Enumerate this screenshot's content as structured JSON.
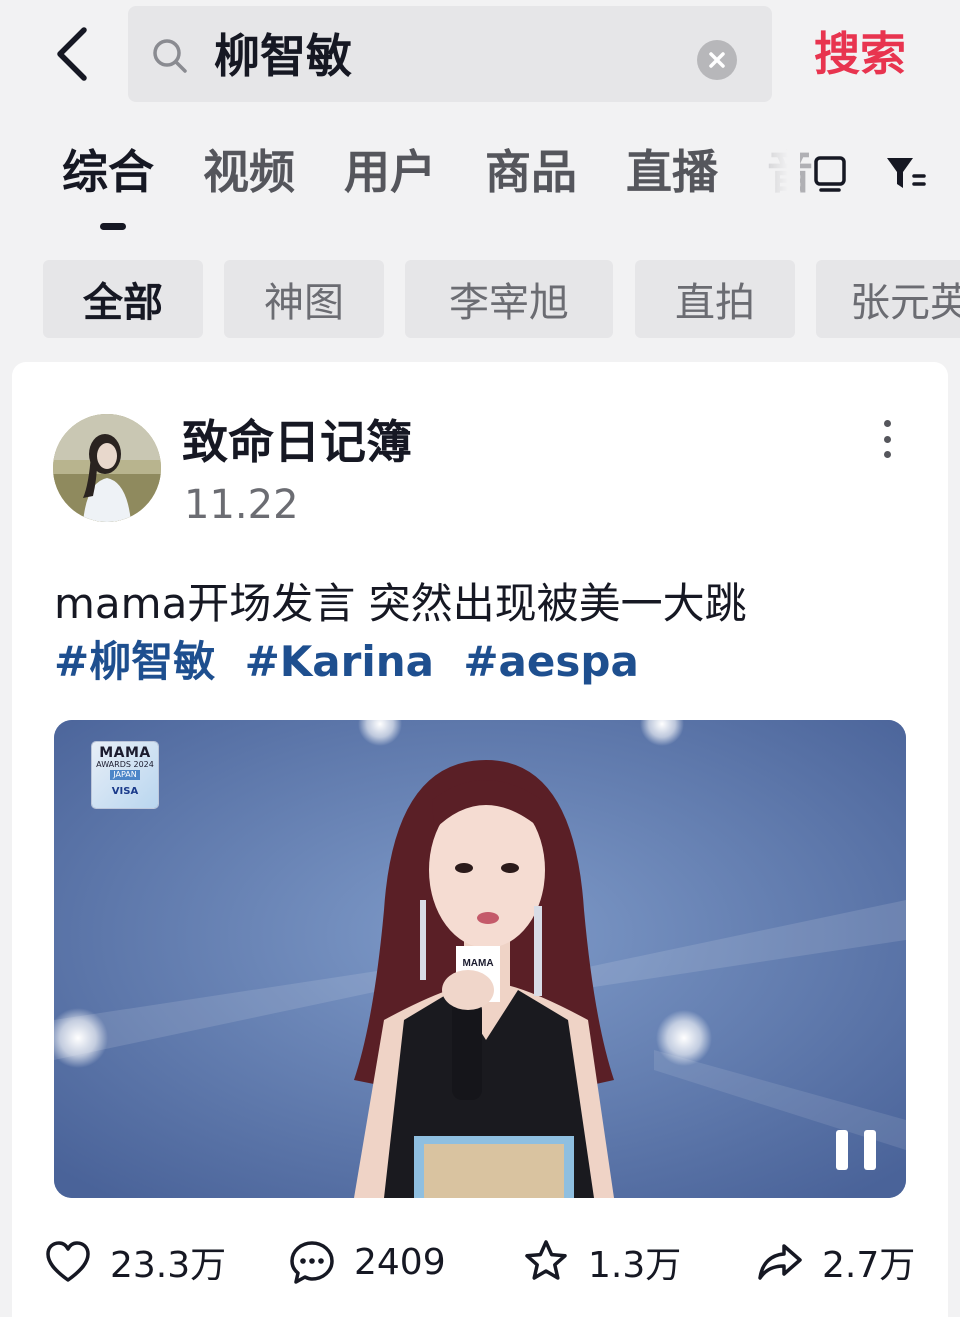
{
  "search": {
    "query": "柳智敏",
    "submit_label": "搜索"
  },
  "tabs": [
    {
      "label": "综合",
      "active": true
    },
    {
      "label": "视频"
    },
    {
      "label": "用户"
    },
    {
      "label": "商品"
    },
    {
      "label": "直播"
    },
    {
      "label": "音"
    }
  ],
  "tab_icons": [
    "screen-icon",
    "filter-icon"
  ],
  "chips": [
    {
      "label": "全部",
      "active": true
    },
    {
      "label": "神图"
    },
    {
      "label": "李宰旭"
    },
    {
      "label": "直拍"
    },
    {
      "label": "张元英"
    }
  ],
  "post": {
    "author": "致命日记簿",
    "date": "11.22",
    "caption": "mama开场发言 突然出现被美一大跳",
    "hashtags": [
      "#柳智敏",
      "#Karina",
      "#aespa"
    ],
    "video": {
      "logo_line1": "MAMA",
      "logo_line2": "AWARDS 2024",
      "logo_line3": "JAPAN",
      "logo_line4": "VISA",
      "mic_flag_text": "MAMA",
      "state": "playing"
    },
    "stats": {
      "likes": "23.3万",
      "comments": "2409",
      "favorites": "1.3万",
      "shares": "2.7万"
    }
  },
  "colors": {
    "accent": "#e8344f",
    "hashtag": "#1e4f8f",
    "background": "#f2f2f3"
  }
}
